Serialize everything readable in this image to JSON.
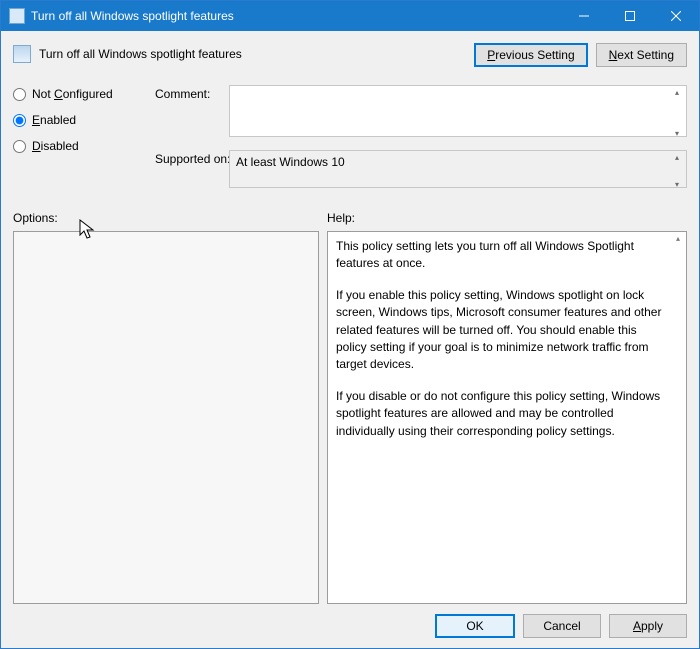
{
  "window": {
    "title": "Turn off all Windows spotlight features"
  },
  "policy": {
    "heading": "Turn off all Windows spotlight features"
  },
  "nav": {
    "previous_P": "P",
    "previous_rest": "revious Setting",
    "next_N": "N",
    "next_rest": "ext Setting"
  },
  "state": {
    "not_configured_C": "C",
    "not_configured_pre": "Not ",
    "not_configured_post": "onfigured",
    "enabled_E": "E",
    "enabled_rest": "nabled",
    "disabled_D": "D",
    "disabled_rest": "isabled",
    "selected": "enabled"
  },
  "labels": {
    "comment": "Comment:",
    "supported": "Supported on:",
    "options": "Options:",
    "help": "Help:"
  },
  "supported_on": "At least Windows 10",
  "comment_value": "",
  "help": {
    "p1": "This policy setting lets you turn off all Windows Spotlight features at once.",
    "p2": "If you enable this policy setting, Windows spotlight on lock screen, Windows tips, Microsoft consumer features and other related features will be turned off. You should enable this policy setting if your goal is to minimize network traffic from target devices.",
    "p3": "If you disable or do not configure this policy setting, Windows spotlight features are allowed and may be controlled individually using their corresponding policy settings."
  },
  "buttons": {
    "ok": "OK",
    "cancel": "Cancel",
    "apply_A": "A",
    "apply_rest": "pply"
  }
}
